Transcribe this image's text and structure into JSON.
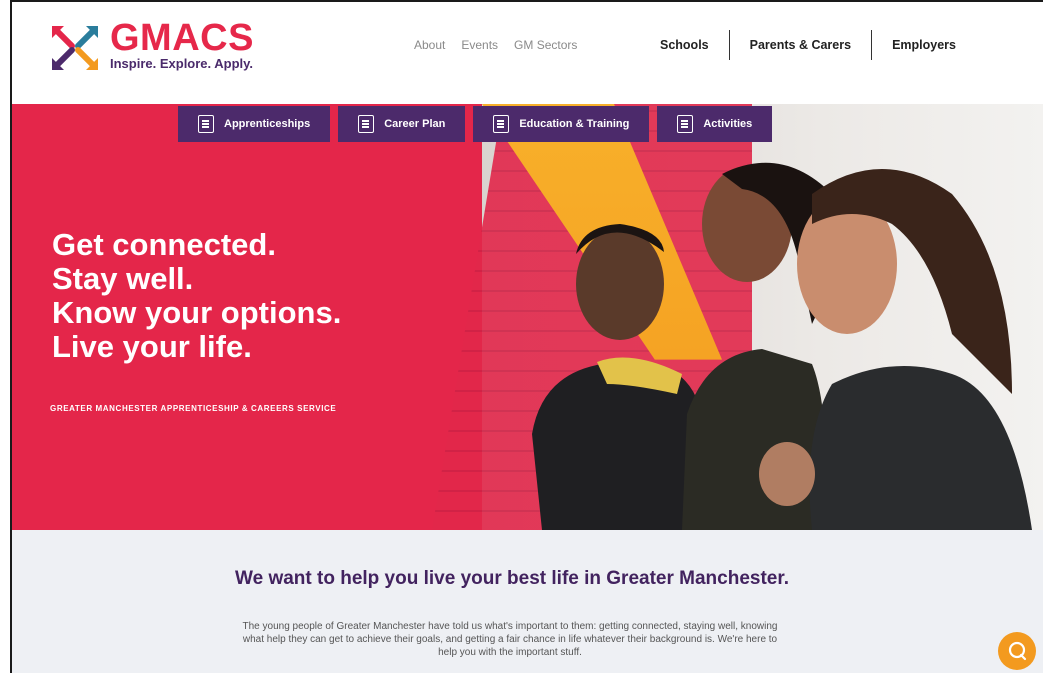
{
  "brand": {
    "name": "GMACS",
    "tagline": "Inspire. Explore. Apply."
  },
  "nav_small": [
    "About",
    "Events",
    "GM Sectors"
  ],
  "nav_main": [
    "Schools",
    "Parents & Carers",
    "Employers"
  ],
  "tabs": [
    {
      "label": "Apprenticeships",
      "icon": "search-document-icon"
    },
    {
      "label": "Career Plan",
      "icon": "clipboard-icon"
    },
    {
      "label": "Education & Training",
      "icon": "map-icon"
    },
    {
      "label": "Activities",
      "icon": "door-icon"
    }
  ],
  "hero": {
    "lines": [
      "Get connected.",
      "Stay well.",
      "Know your options.",
      "Live your life."
    ],
    "subtitle": "GREATER MANCHESTER APPRENTICESHIP & CAREERS SERVICE"
  },
  "intro": {
    "heading": "We want to help you live your best life in Greater Manchester.",
    "body": "The young people of Greater Manchester have told us what's important to them: getting connected, staying well, knowing what help they can get to achieve their goals, and getting a fair chance in life whatever their background is. We're here to help you with the important stuff."
  },
  "colors": {
    "brand_red": "#e4264a",
    "brand_purple": "#4c2a6b",
    "accent_orange": "#f39a1f"
  }
}
